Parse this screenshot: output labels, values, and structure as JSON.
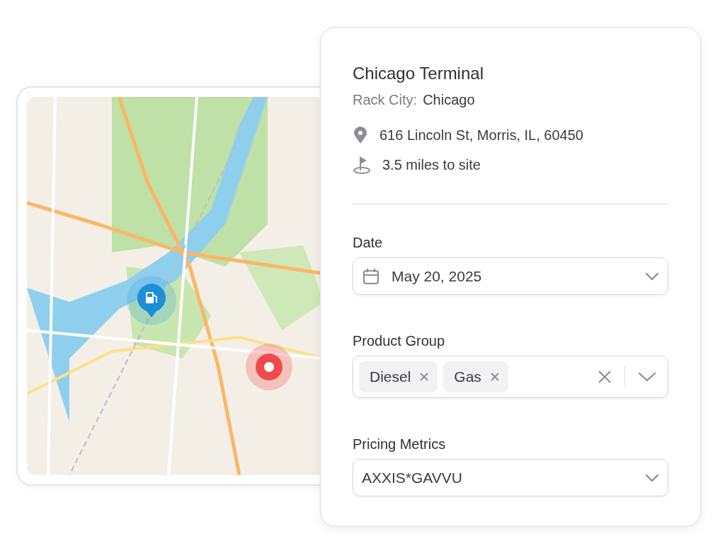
{
  "map": {
    "kind": "picture",
    "markers": [
      {
        "kind": "fuel"
      },
      {
        "kind": "site"
      }
    ]
  },
  "terminal": {
    "title": "Chicago Terminal",
    "rack_city_label": "Rack City:",
    "rack_city": "Chicago",
    "address": "616 Lincoln St, Morris, IL, 60450",
    "distance": "3.5 miles to site"
  },
  "fields": [
    {
      "kind": "date",
      "label": "Date",
      "value": "May 20, 2025"
    },
    {
      "kind": "multiselect",
      "label": "Product Group",
      "tags": [
        "Diesel",
        "Gas"
      ]
    },
    {
      "kind": "select",
      "label": "Pricing Metrics",
      "value": "AXXIS*GAVVU"
    }
  ]
}
